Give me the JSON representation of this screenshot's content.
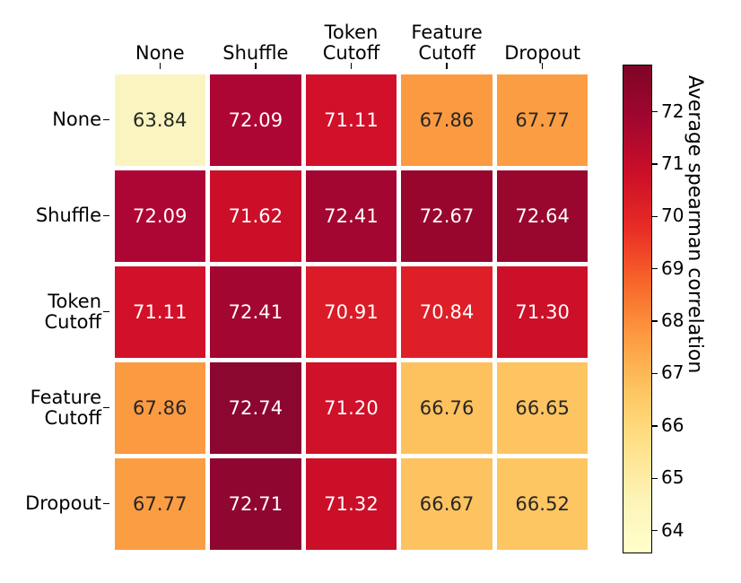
{
  "chart_data": {
    "type": "heatmap",
    "title": "",
    "xlabel": "",
    "ylabel": "",
    "categories_x": [
      "None",
      "Shuffle",
      "Token\nCutoff",
      "Feature\nCutoff",
      "Dropout"
    ],
    "categories_y": [
      "None",
      "Shuffle",
      "Token\nCutoff",
      "Feature\nCutoff",
      "Dropout"
    ],
    "rows": [
      {
        "label": "None",
        "values": [
          63.84,
          72.09,
          71.11,
          67.86,
          67.77
        ]
      },
      {
        "label": "Shuffle",
        "values": [
          72.09,
          71.62,
          72.41,
          72.67,
          72.64
        ]
      },
      {
        "label": "Token\nCutoff",
        "values": [
          71.11,
          72.41,
          70.91,
          70.84,
          71.3
        ]
      },
      {
        "label": "Feature\nCutoff",
        "values": [
          67.86,
          72.74,
          71.2,
          66.76,
          66.65
        ]
      },
      {
        "label": "Dropout",
        "values": [
          67.77,
          72.71,
          71.32,
          66.67,
          66.52
        ]
      }
    ],
    "cell_text": [
      [
        "63.84",
        "72.09",
        "71.11",
        "67.86",
        "67.77"
      ],
      [
        "72.09",
        "71.62",
        "72.41",
        "72.67",
        "72.64"
      ],
      [
        "71.11",
        "72.41",
        "70.91",
        "70.84",
        "71.30"
      ],
      [
        "67.86",
        "72.74",
        "71.20",
        "66.76",
        "66.65"
      ],
      [
        "67.77",
        "72.71",
        "71.32",
        "66.67",
        "66.52"
      ]
    ],
    "cell_colors": [
      [
        "#FAF5C0",
        "#AE0634",
        "#D3102A",
        "#FB9A41",
        "#FB9D43"
      ],
      [
        "#AE0634",
        "#CB0F28",
        "#A30630",
        "#98062E",
        "#99062E"
      ],
      [
        "#D3102A",
        "#A30630",
        "#DC1B28",
        "#DE1F28",
        "#CD1029"
      ],
      [
        "#FB9A41",
        "#8C0730",
        "#CF1129",
        "#FDC15E",
        "#FDC461"
      ],
      [
        "#FB9D43",
        "#8F0730",
        "#CB0F28",
        "#FDC360",
        "#FDC663"
      ]
    ],
    "cell_text_colors": [
      [
        "#262626",
        "#ffffff",
        "#ffffff",
        "#262626",
        "#262626"
      ],
      [
        "#ffffff",
        "#ffffff",
        "#ffffff",
        "#ffffff",
        "#ffffff"
      ],
      [
        "#ffffff",
        "#ffffff",
        "#ffffff",
        "#ffffff",
        "#ffffff"
      ],
      [
        "#262626",
        "#ffffff",
        "#ffffff",
        "#262626",
        "#262626"
      ],
      [
        "#262626",
        "#ffffff",
        "#ffffff",
        "#262626",
        "#262626"
      ]
    ],
    "colorbar": {
      "label": "Average spearman correlation",
      "ticks": [
        "72",
        "71",
        "70",
        "69",
        "68",
        "67",
        "66",
        "65",
        "64"
      ],
      "tick_values": [
        72,
        71,
        70,
        69,
        68,
        67,
        66,
        65,
        64
      ],
      "vmin": 63.6,
      "vmax": 72.9,
      "colormap": "YlOrRd reversed-dark-top",
      "stops": [
        "#7E0526",
        "#A20630",
        "#CB0F28",
        "#E82C26",
        "#F8652A",
        "#FD9A41",
        "#FDC561",
        "#FEE189",
        "#FEF3B6",
        "#FFFFCC"
      ],
      "orientation": "vertical"
    },
    "grid": {
      "show": true,
      "gap_color": "#ffffff"
    }
  }
}
